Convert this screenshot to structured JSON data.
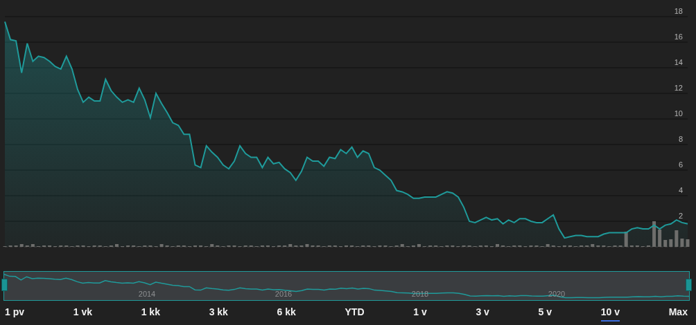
{
  "chart": {
    "chart_data": {
      "type": "area",
      "grid": true,
      "ylim": [
        0,
        18
      ],
      "yticks": [
        2,
        4,
        6,
        8,
        10,
        12,
        14,
        16,
        18
      ],
      "series": [
        {
          "color": "#1f9b9b",
          "values": [
            17.6,
            16.2,
            16.1,
            13.6,
            15.9,
            14.5,
            14.9,
            14.8,
            14.5,
            14.1,
            13.9,
            14.9,
            13.9,
            12.3,
            11.3,
            11.7,
            11.4,
            11.4,
            13.1,
            12.2,
            11.7,
            11.3,
            11.5,
            11.3,
            12.4,
            11.5,
            10.1,
            12.0,
            11.2,
            10.5,
            9.7,
            9.5,
            8.8,
            8.8,
            6.4,
            6.2,
            7.9,
            7.4,
            7.0,
            6.4,
            6.1,
            6.7,
            7.9,
            7.3,
            7.0,
            7.0,
            6.2,
            7.0,
            6.5,
            6.6,
            6.1,
            5.8,
            5.2,
            5.9,
            7.0,
            6.7,
            6.7,
            6.3,
            7.0,
            6.9,
            7.6,
            7.3,
            7.8,
            7.0,
            7.5,
            7.3,
            6.2,
            6.0,
            5.6,
            5.2,
            4.4,
            4.3,
            4.1,
            3.8,
            3.8,
            3.9,
            3.9,
            3.9,
            4.1,
            4.3,
            4.2,
            3.9,
            3.1,
            2.0,
            1.9,
            2.1,
            2.3,
            2.1,
            2.2,
            1.8,
            2.1,
            1.9,
            2.2,
            2.2,
            2.0,
            1.9,
            1.9,
            2.2,
            2.5,
            1.4,
            0.7,
            0.8,
            0.9,
            0.9,
            0.8,
            0.8,
            0.8,
            1.0,
            1.1,
            1.1,
            1.1,
            1.1,
            1.4,
            1.5,
            1.4,
            1.4,
            1.7,
            1.4,
            1.7,
            1.8,
            2.1,
            1.9,
            1.8
          ]
        }
      ]
    }
  },
  "navigator": {
    "year_labels": [
      "2014",
      "2016",
      "2018",
      "2020"
    ]
  },
  "ranges": [
    {
      "label": "1 pv",
      "selected": false
    },
    {
      "label": "1 vk",
      "selected": false
    },
    {
      "label": "1 kk",
      "selected": false
    },
    {
      "label": "3 kk",
      "selected": false
    },
    {
      "label": "6 kk",
      "selected": false
    },
    {
      "label": "YTD",
      "selected": false
    },
    {
      "label": "1 v",
      "selected": false
    },
    {
      "label": "3 v",
      "selected": false
    },
    {
      "label": "5 v",
      "selected": false
    },
    {
      "label": "10 v",
      "selected": true
    },
    {
      "label": "Max",
      "selected": false
    }
  ]
}
